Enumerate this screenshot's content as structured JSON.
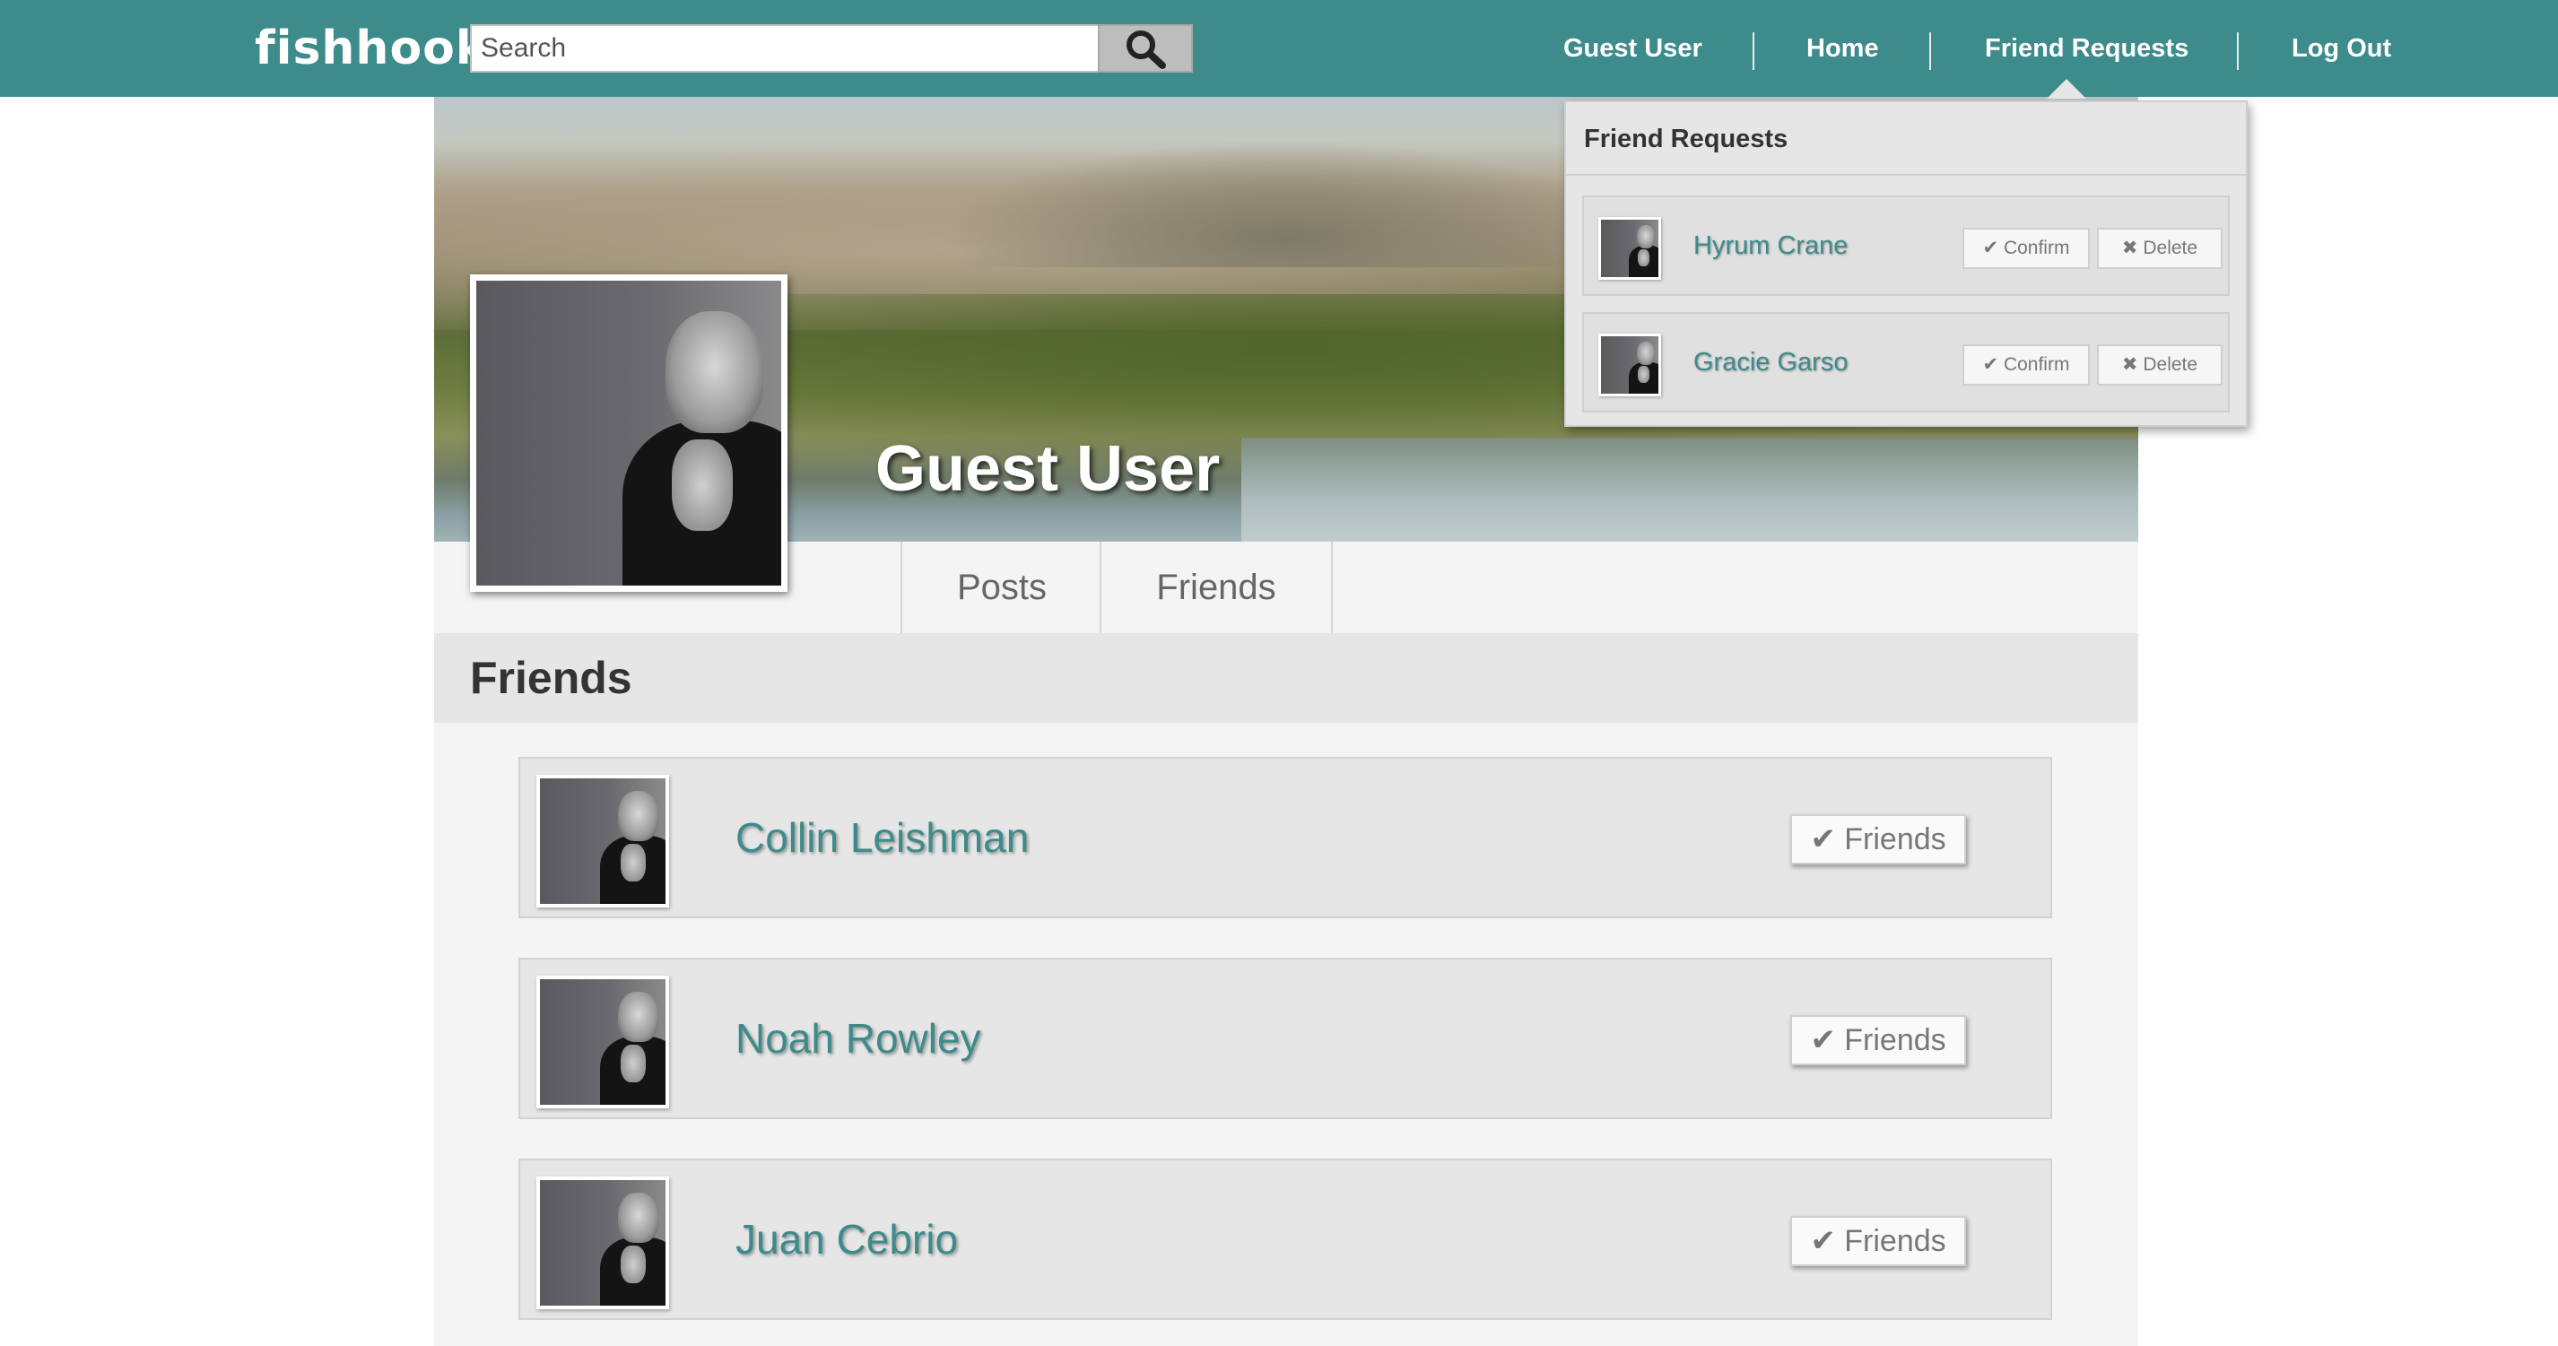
{
  "header": {
    "logo": "fishhook",
    "search": {
      "placeholder": "Search",
      "value": ""
    },
    "nav": {
      "guest_user": "Guest User",
      "home": "Home",
      "friend_requests": "Friend Requests",
      "logout": "Log Out"
    },
    "accent_color": "#3d8b8b"
  },
  "profile": {
    "name": "Guest User",
    "tabs": [
      {
        "label": "Posts"
      },
      {
        "label": "Friends"
      }
    ]
  },
  "friends_section": {
    "title": "Friends",
    "friends": [
      {
        "name": "Collin Leishman",
        "status_label": "✔ Friends"
      },
      {
        "name": "Noah Rowley",
        "status_label": "✔ Friends"
      },
      {
        "name": "Juan Cebrio",
        "status_label": "✔ Friends"
      }
    ]
  },
  "friend_requests_dropdown": {
    "title": "Friend Requests",
    "requests": [
      {
        "name": "Hyrum Crane",
        "confirm_label": "✔ Confirm",
        "delete_label": "✖ Delete"
      },
      {
        "name": "Gracie Garso",
        "confirm_label": "✔ Confirm",
        "delete_label": "✖ Delete"
      }
    ]
  }
}
